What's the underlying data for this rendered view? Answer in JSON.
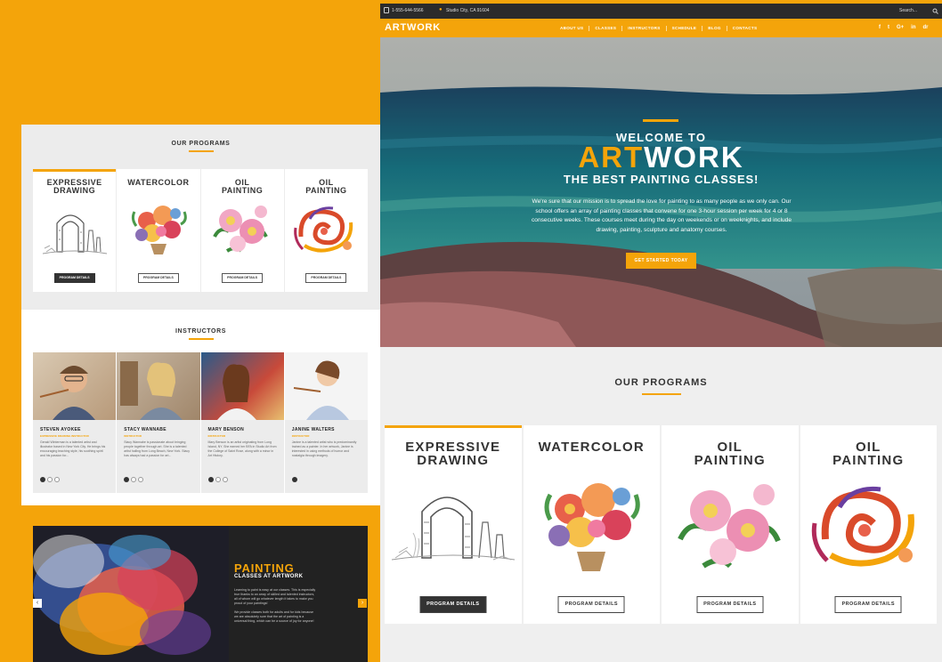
{
  "left": {
    "programs": {
      "title": "OUR PROGRAMS",
      "cards": [
        {
          "title": "EXPRESSIVE DRAWING",
          "button": "PROGRAM DETAILS"
        },
        {
          "title": "WATERCOLOR",
          "button": "PROGRAM DETAILS"
        },
        {
          "title": "OIL PAINTING",
          "button": "PROGRAM DETAILS"
        },
        {
          "title": "OIL PAINTING",
          "button": "PROGRAM DETAILS"
        }
      ]
    },
    "instructors": {
      "title": "INSTRUCTORS",
      "items": [
        {
          "name": "STEVEN AYOKEE",
          "role": "EXPRESSIVE DRAWING INSTRUCTOR",
          "desc": "Gerald Winterman is a talented artist and illustrator based in New York City. He brings his encouraging teaching style, his soothing spirit and his passion for..."
        },
        {
          "name": "STACY WANNABE",
          "role": "INSTRUCTOR",
          "desc": "Stacy Wannabe is passionate about bringing people together through art. She is a talented artist hailing from Long Beach, New York. Stacy has always had a passion for art..."
        },
        {
          "name": "MARY BENSON",
          "role": "INSTRUCTOR",
          "desc": "Mary Benson is an artist originating from Long Island, NY. She earned her BFA in Studio Art from the College of Saint Rose, along with a minor in Art History."
        },
        {
          "name": "JANINE WALTERS",
          "role": "INSTRUCTOR",
          "desc": "Janine is a talented artist who is predominantly trained as a painter. In her artwork, Janine is interested in using methods of humor and nostalgia through imagery."
        }
      ]
    },
    "painting": {
      "title": "PAINTING",
      "subtitle": "CLASSES AT ARTWORK",
      "para1": "Learning to paint is easy at our classes. This is especially true thanks to an array of skilled and talented instructors, all of whom will go whatever length it takes to make you proud of your paintings!",
      "para2": "We provide classes both for adults and for kids because we are absolutely sure that the art of painting is a universal thing, which can be a source of joy for anyone!",
      "prev": "‹",
      "next": "›"
    }
  },
  "right": {
    "topbar": {
      "phone": "1-555-644-5566",
      "location": "Studio City, CA 91604",
      "search_placeholder": "Search..."
    },
    "logo": "ARTWORK",
    "menu": [
      "ABOUT US",
      "CLASSES",
      "INSTRUCTORS",
      "SCHEDULE",
      "BLOG",
      "CONTACTS"
    ],
    "social_icons": [
      "f",
      "t",
      "G+",
      "in",
      "dr"
    ],
    "hero": {
      "welcome": "WELCOME TO",
      "brand_a": "ART",
      "brand_b": "WORK",
      "subtitle": "THE BEST PAINTING CLASSES!",
      "description": "We're sure that our mission is to spread the love for painting to as many people as we only can. Our school offers an array of painting classes that convene for one 3-hour session per week for 4 or 8 consecutive weeks. These courses meet during the day on weekends or on weeknights, and include drawing, painting, sculpture and anatomy courses.",
      "button": "GET STARTED TODAY"
    },
    "programs": {
      "title": "OUR PROGRAMS",
      "cards": [
        {
          "title": "EXPRESSIVE DRAWING",
          "button": "PROGRAM DETAILS"
        },
        {
          "title": "WATERCOLOR",
          "button": "PROGRAM DETAILS"
        },
        {
          "title": "OIL PAINTING",
          "button": "PROGRAM DETAILS"
        },
        {
          "title": "OIL PAINTING",
          "button": "PROGRAM DETAILS"
        }
      ]
    }
  },
  "colors": {
    "accent": "#f4a40a",
    "dark": "#2b2b2b",
    "panel": "#efefef"
  }
}
